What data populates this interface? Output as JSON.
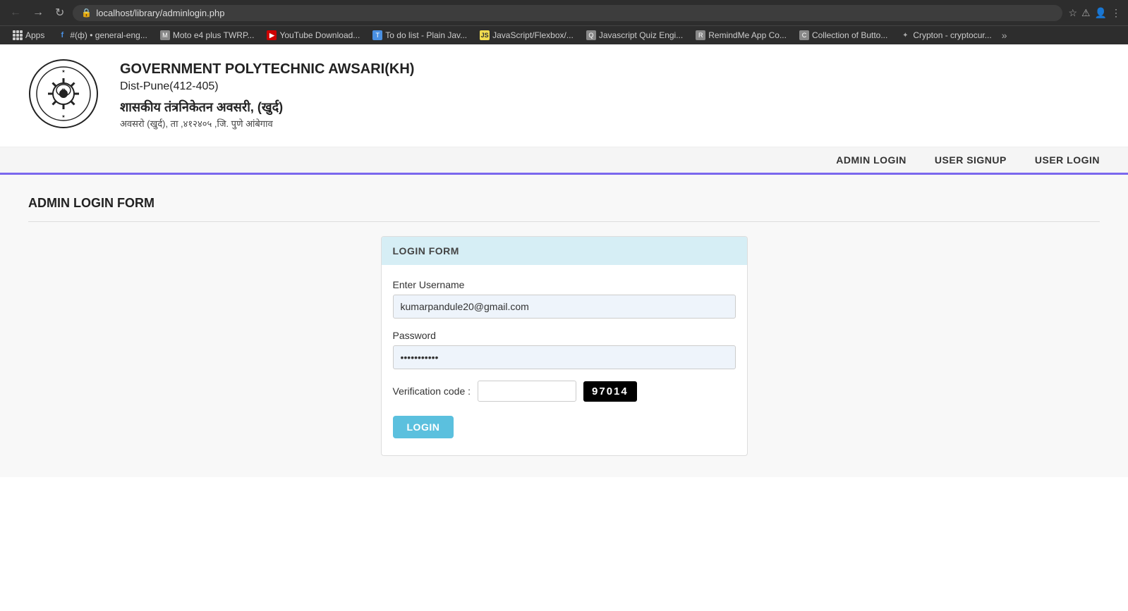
{
  "browser": {
    "url": "localhost/library/adminlogin.php",
    "back_btn": "←",
    "forward_btn": "→",
    "refresh_btn": "↻",
    "bookmarks": [
      {
        "id": "apps",
        "label": "Apps",
        "icon_type": "grid"
      },
      {
        "id": "general-eng",
        "label": "#(ф) • general-eng...",
        "icon_type": "blue"
      },
      {
        "id": "moto",
        "label": "Moto e4 plus TWRP...",
        "icon_type": "moto"
      },
      {
        "id": "youtube",
        "label": "YouTube Download...",
        "icon_type": "youtube"
      },
      {
        "id": "todo",
        "label": "To do list - Plain Jav...",
        "icon_type": "todo"
      },
      {
        "id": "javascript",
        "label": "JavaScript/Flexbox/...",
        "icon_type": "js"
      },
      {
        "id": "quiz",
        "label": "Javascript Quiz Engi...",
        "icon_type": "quiz"
      },
      {
        "id": "remindme",
        "label": "RemindMe App Co...",
        "icon_type": "remind"
      },
      {
        "id": "collection",
        "label": "Collection of Butto...",
        "icon_type": "collection"
      },
      {
        "id": "crypton",
        "label": "Crypton - cryptocur...",
        "icon_type": "crypton"
      }
    ]
  },
  "header": {
    "college_name_en": "GOVERNMENT POLYTECHNIC AWSARI(KH)",
    "college_dist": "Dist-Pune(412-405)",
    "college_name_hi": "शासकीय  तंत्रनिकेतन अवसरी, (खुर्द)",
    "college_addr_hi": "अवसरो (खुर्द), ता ,४१२४०५ ,जि. पुणे  आंबेगाव"
  },
  "navbar": {
    "links": [
      {
        "id": "admin-login",
        "label": "ADMIN LOGIN"
      },
      {
        "id": "user-signup",
        "label": "USER SIGNUP"
      },
      {
        "id": "user-login",
        "label": "USER LOGIN"
      }
    ]
  },
  "page": {
    "form_title": "ADMIN LOGIN FORM",
    "card_header": "LOGIN FORM",
    "username_label": "Enter Username",
    "username_value": "kumarpandule20@gmail.com",
    "password_label": "Password",
    "password_value": "••••••••",
    "verification_label": "Verification code :",
    "verification_input_value": "",
    "captcha_value": "97014",
    "login_button_label": "LOGIN"
  }
}
